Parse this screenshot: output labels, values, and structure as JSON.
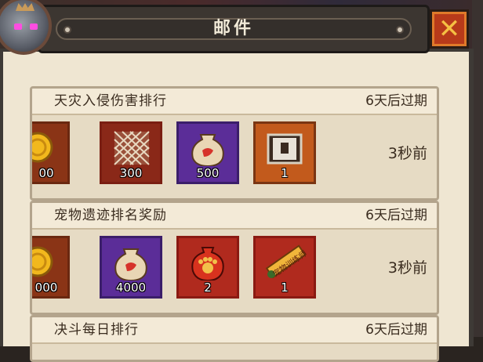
{
  "window": {
    "title": "邮件",
    "close_label": "✕"
  },
  "mails": [
    {
      "title": "天灾入侵伤害排行",
      "expiry": "6天后过期",
      "time_ago": "3秒前",
      "items": [
        {
          "icon": "gold-coin-icon",
          "count": "00",
          "frame": "gold"
        },
        {
          "icon": "net-icon",
          "count": "300",
          "frame": "red"
        },
        {
          "icon": "pouch-icon",
          "count": "500",
          "frame": "purple"
        },
        {
          "icon": "chest-icon",
          "count": "1",
          "frame": "orange"
        }
      ]
    },
    {
      "title": "宠物遗迹排名奖励",
      "expiry": "6天后过期",
      "time_ago": "3秒前",
      "items": [
        {
          "icon": "gold-coin-icon",
          "count": "000",
          "frame": "gold"
        },
        {
          "icon": "pouch-icon",
          "count": "4000",
          "frame": "purple"
        },
        {
          "icon": "paw-bag-icon",
          "count": "2",
          "frame": "red"
        },
        {
          "icon": "training-scroll-icon",
          "count": "1",
          "frame": "red",
          "label": "宠物训练师"
        }
      ]
    },
    {
      "title": "决斗每日排行",
      "expiry": "6天后过期"
    }
  ]
}
